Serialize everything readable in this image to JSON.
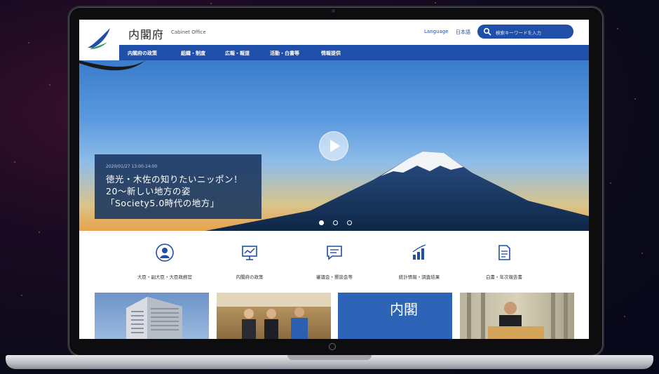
{
  "site": {
    "title": "内閣府",
    "title_en": "Cabinet Office",
    "language_label": "Language",
    "language_current": "日本語",
    "search_placeholder": "検索キーワードを入力"
  },
  "nav": {
    "items": [
      {
        "label": "内閣府の政策"
      },
      {
        "label": "組織・制度"
      },
      {
        "label": "広報・報道"
      },
      {
        "label": "活動・白書等"
      },
      {
        "label": "情報提供"
      }
    ]
  },
  "hero": {
    "date": "2020/01/27 13:00-14:00",
    "title_line1": "徳光・木佐の知りたいニッポン！",
    "title_line2": "20～新しい地方の姿",
    "title_line3": "「Society5.0時代の地方」",
    "slides_total": 3,
    "slide_active": 1
  },
  "quick_links": [
    {
      "label": "大臣・副大臣・大臣政務官",
      "icon": "person-icon"
    },
    {
      "label": "内閣府の政策",
      "icon": "presentation-icon"
    },
    {
      "label": "審議会・懇談会等",
      "icon": "chat-icon"
    },
    {
      "label": "統計情報・調査結果",
      "icon": "bar-chart-icon"
    },
    {
      "label": "白書・年次報告書",
      "icon": "document-icon"
    }
  ],
  "thumbnails": {
    "text_tile_kanji": "内閣"
  },
  "colors": {
    "brand_blue": "#1f4fa8",
    "hero_card": "#18345e"
  }
}
